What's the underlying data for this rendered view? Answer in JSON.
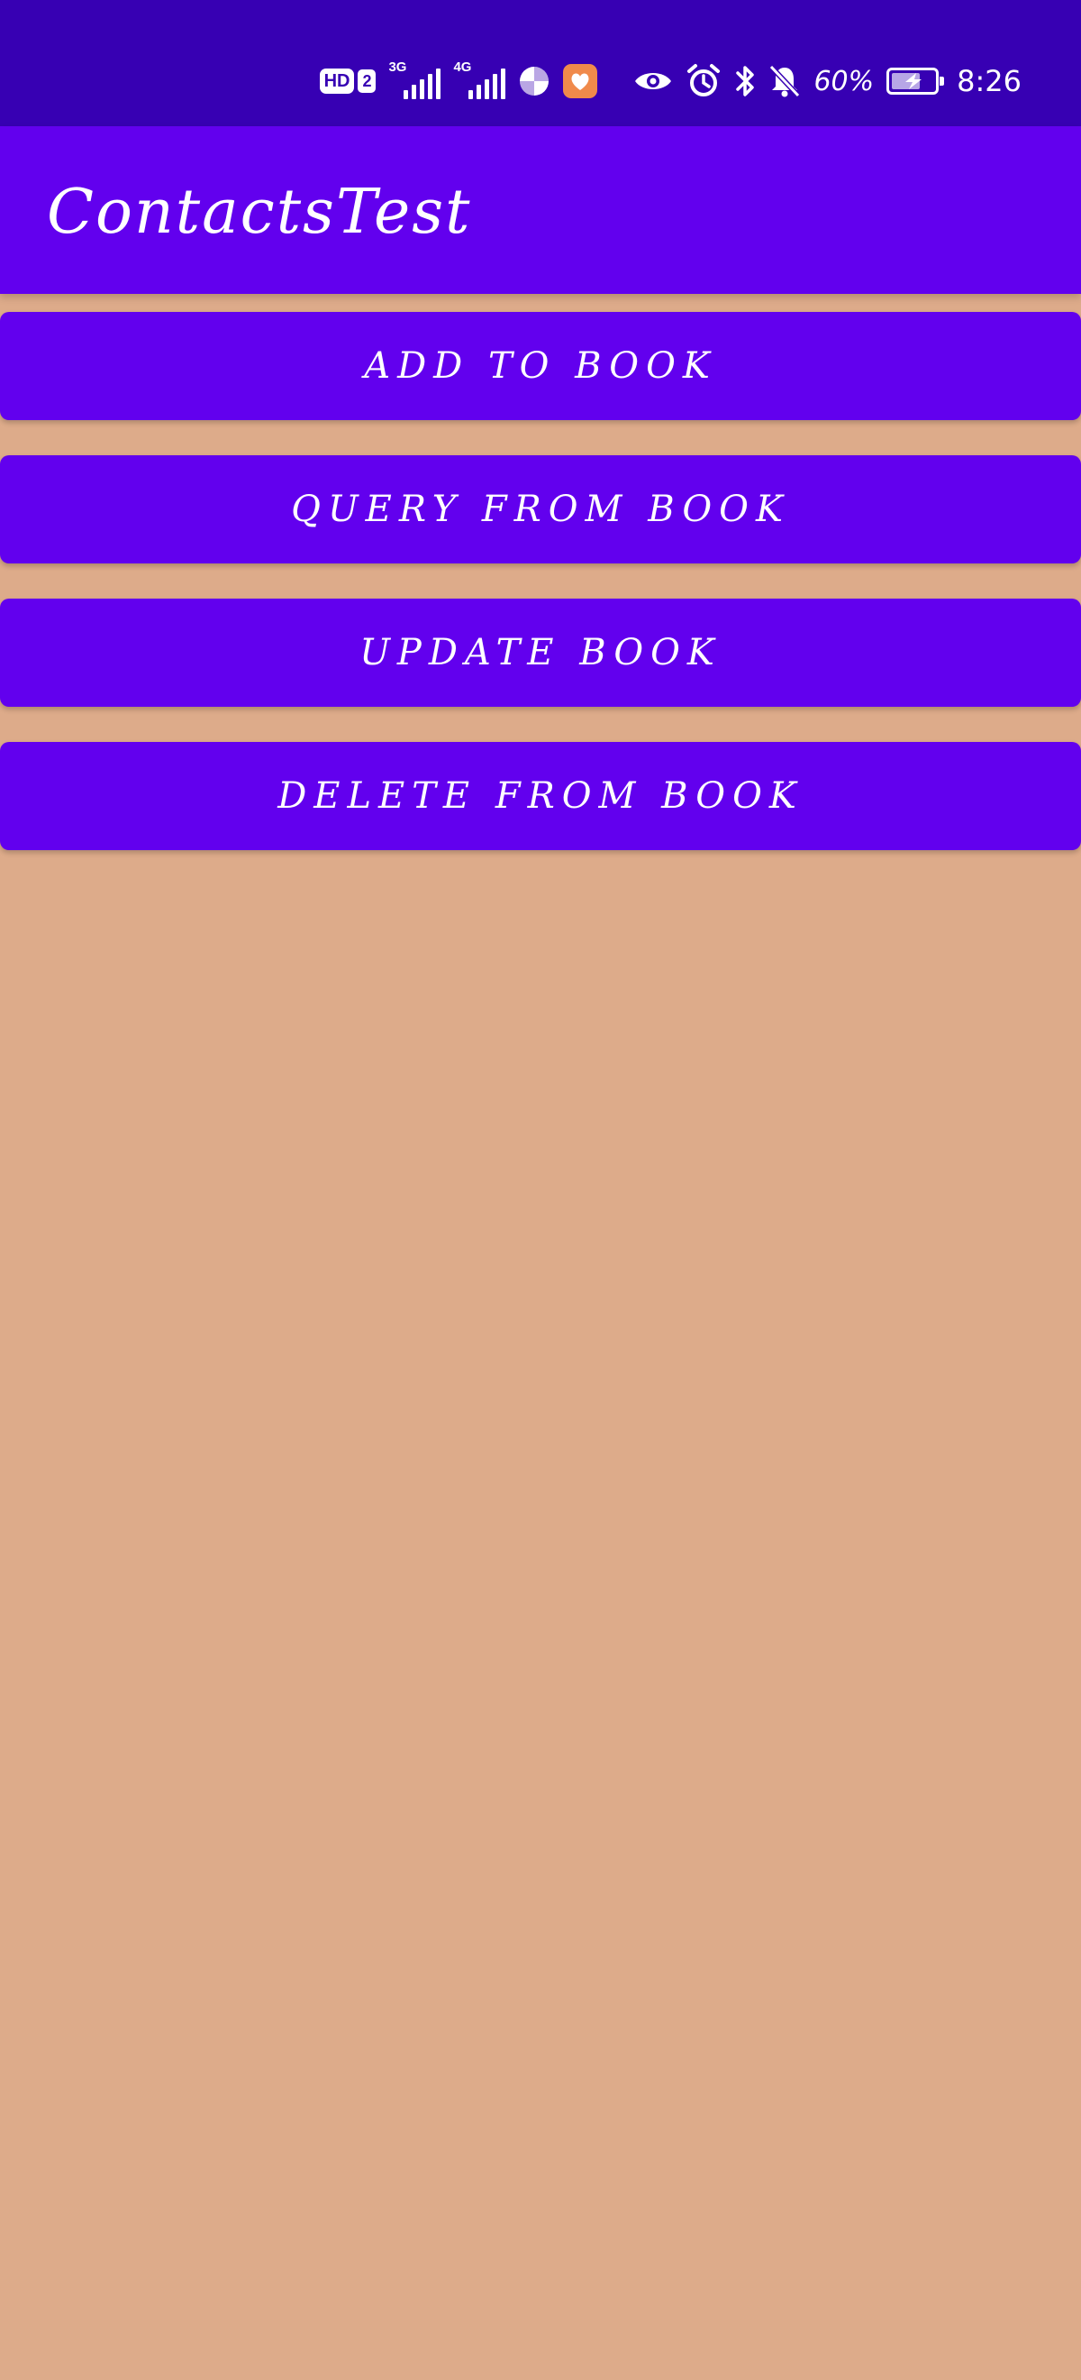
{
  "status_bar": {
    "hd_label": "HD",
    "sim_label": "2",
    "signal_1_tag": "3G",
    "signal_2_tag": "4G",
    "battery_percent": "60%",
    "time": "8:26",
    "icons": [
      "hd-icon",
      "sim-2-icon",
      "signal-3g-icon",
      "signal-4g-icon",
      "browser-app-icon",
      "health-app-icon",
      "eye-comfort-icon",
      "alarm-icon",
      "bluetooth-icon",
      "notifications-muted-icon",
      "battery-charging-icon"
    ]
  },
  "app_bar": {
    "title": "ContactsTest"
  },
  "buttons": {
    "add": "ADD TO BOOK",
    "query": "QUERY FROM BOOK",
    "update": "UPDATE BOOK",
    "delete": "DELETE FROM BOOK"
  },
  "colors": {
    "status_bar": "#3700B3",
    "primary": "#6200EE",
    "background": "#DDAB8A",
    "health_app": "#F08A4B"
  }
}
